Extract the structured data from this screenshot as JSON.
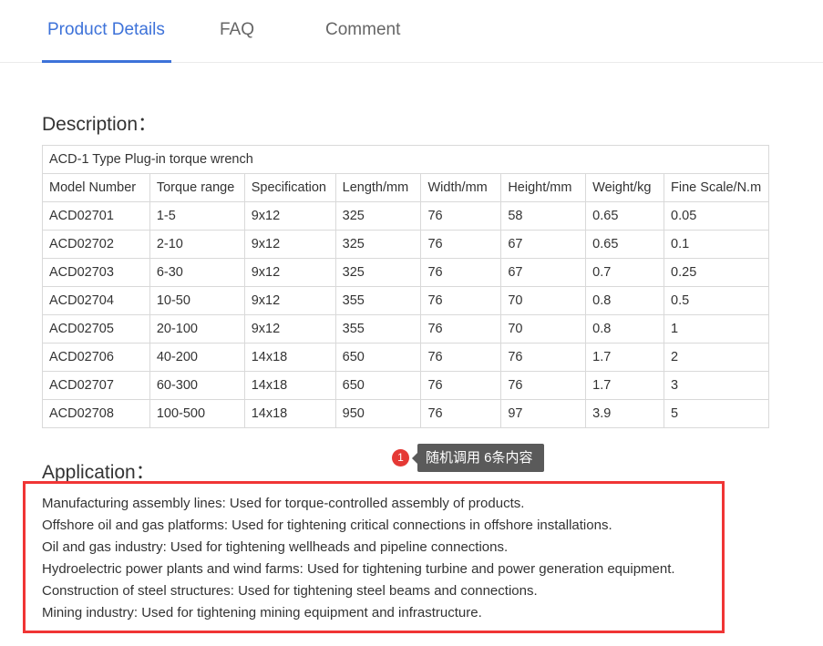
{
  "tabs": [
    {
      "label": "Product Details",
      "active": true
    },
    {
      "label": "FAQ",
      "active": false
    },
    {
      "label": "Comment",
      "active": false
    }
  ],
  "description": {
    "title": "Description：",
    "table_caption": "ACD-1 Type Plug-in torque wrench",
    "columns": [
      "Model Number",
      "Torque range",
      "Specification",
      "Length/mm",
      "Width/mm",
      "Height/mm",
      "Weight/kg",
      "Fine Scale/N.m"
    ],
    "rows": [
      [
        "ACD02701",
        "1-5",
        "9x12",
        "325",
        "76",
        "58",
        "0.65",
        "0.05"
      ],
      [
        "ACD02702",
        "2-10",
        "9x12",
        "325",
        "76",
        "67",
        "0.65",
        "0.1"
      ],
      [
        "ACD02703",
        "6-30",
        "9x12",
        "325",
        "76",
        "67",
        "0.7",
        "0.25"
      ],
      [
        "ACD02704",
        "10-50",
        "9x12",
        "355",
        "76",
        "70",
        "0.8",
        "0.5"
      ],
      [
        "ACD02705",
        "20-100",
        "9x12",
        "355",
        "76",
        "70",
        "0.8",
        "1"
      ],
      [
        "ACD02706",
        "40-200",
        "14x18",
        "650",
        "76",
        "76",
        "1.7",
        "2"
      ],
      [
        "ACD02707",
        "60-300",
        "14x18",
        "650",
        "76",
        "76",
        "1.7",
        "3"
      ],
      [
        "ACD02708",
        "100-500",
        "14x18",
        "950",
        "76",
        "97",
        "3.9",
        "5"
      ]
    ]
  },
  "tooltip": {
    "badge": "1",
    "text": "随机调用 6条内容"
  },
  "application": {
    "title": "Application：",
    "items": [
      "Manufacturing assembly lines: Used for torque-controlled assembly of products.",
      "Offshore oil and gas platforms: Used for tightening critical connections in offshore installations.",
      "Oil and gas industry: Used for tightening wellheads and pipeline connections.",
      "Hydroelectric power plants and wind farms: Used for tightening turbine and power generation equipment.",
      "Construction of steel structures: Used for tightening steel beams and connections.",
      "Mining industry: Used for tightening mining equipment and infrastructure."
    ]
  },
  "colors": {
    "accent": "#3d72d9",
    "highlight_border": "#f03535",
    "badge": "#e53935",
    "tooltip_bg": "#5a5a5a"
  }
}
